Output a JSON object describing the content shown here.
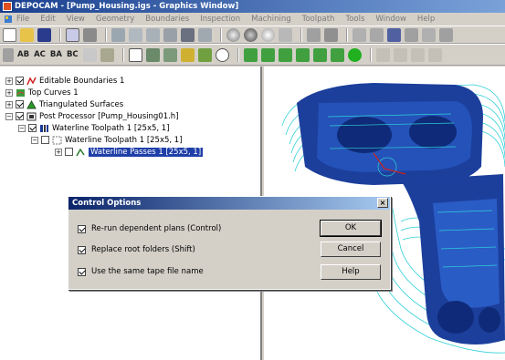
{
  "window": {
    "title": "DEPOCAM - [Pump_Housing.igs - Graphics Window]"
  },
  "menu": [
    "File",
    "Edit",
    "View",
    "Geometry",
    "Boundaries",
    "Inspection",
    "Machining",
    "Toolpath",
    "Tools",
    "Window",
    "Help"
  ],
  "toolbar2_text": [
    "AB",
    "AC",
    "BA",
    "BC"
  ],
  "tree": {
    "items": [
      {
        "label": "Editable Boundaries 1"
      },
      {
        "label": "Top Curves 1"
      },
      {
        "label": "Triangulated Surfaces"
      },
      {
        "label": "Post Processor [Pump_Housing01.h]"
      },
      {
        "label": "Waterline Toolpath 1 [25x5, 1]"
      },
      {
        "label": "Waterline Toolpath 1 [25x5, 1]"
      },
      {
        "label": "Waterline Passes 1 [25x5, 1]"
      }
    ]
  },
  "dialog": {
    "title": "Control Options",
    "close": "×",
    "options": [
      {
        "label": "Re-run dependent plans (Control)",
        "checked": true
      },
      {
        "label": "Replace root folders (Shift)",
        "checked": true
      },
      {
        "label": "Use the same tape file name",
        "checked": true
      }
    ],
    "buttons": {
      "ok": "OK",
      "cancel": "Cancel",
      "help": "Help"
    }
  },
  "colors": {
    "model_blue": "#1c3f9c",
    "toolpath_cyan": "#2fd0d8",
    "selection": "#1f3fa8"
  }
}
